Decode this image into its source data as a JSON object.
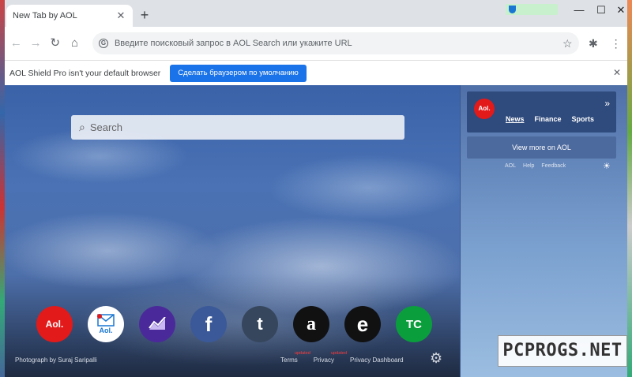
{
  "tab": {
    "title": "New Tab by AOL",
    "close_glyph": "✕",
    "new_tab_glyph": "+"
  },
  "window_controls": {
    "minimize": "—",
    "maximize": "☐",
    "close": "✕"
  },
  "toolbar": {
    "back_glyph": "←",
    "forward_glyph": "→",
    "reload_glyph": "↻",
    "home_glyph": "⌂",
    "omnibox_icon": "G",
    "omnibox_placeholder": "Введите поисковый запрос в AOL Search или укажите URL",
    "bookmark_glyph": "☆",
    "extensions_glyph": "✱",
    "menu_glyph": "⋮"
  },
  "infobar": {
    "text": "AOL Shield Pro isn't your default browser",
    "button": "Сделать браузером по умолчанию",
    "close_glyph": "✕"
  },
  "search": {
    "placeholder": "Search",
    "icon_glyph": "⌕"
  },
  "shortcuts": [
    {
      "name": "aol",
      "label": "Aol.",
      "color": "#e21a1a"
    },
    {
      "name": "aol-mail",
      "label": "Aol.",
      "color": "#ffffff"
    },
    {
      "name": "finance",
      "label": "",
      "color": "#4a2a9a"
    },
    {
      "name": "facebook",
      "label": "f",
      "color": "#3b5998"
    },
    {
      "name": "tumblr",
      "label": "t",
      "color": "#36465d"
    },
    {
      "name": "amazon",
      "label": "a",
      "color": "#111111"
    },
    {
      "name": "engadget",
      "label": "e",
      "color": "#111111"
    },
    {
      "name": "techcrunch",
      "label": "TC",
      "color": "#0a9e3c"
    }
  ],
  "footer": {
    "photo_credit": "Photograph by Suraj Saripalli",
    "terms": "Terms",
    "privacy": "Privacy",
    "privacy_dashboard": "Privacy Dashboard",
    "updated": "updated",
    "gear_glyph": "⚙"
  },
  "side_panel": {
    "logo": "Aol.",
    "chevron": "»",
    "tabs": [
      "News",
      "Finance",
      "Sports"
    ],
    "view_more": "View more on AOL",
    "links": [
      "AOL",
      "Help",
      "Feedback"
    ],
    "sun_glyph": "☀"
  },
  "watermark": "PCPROGS.NET"
}
